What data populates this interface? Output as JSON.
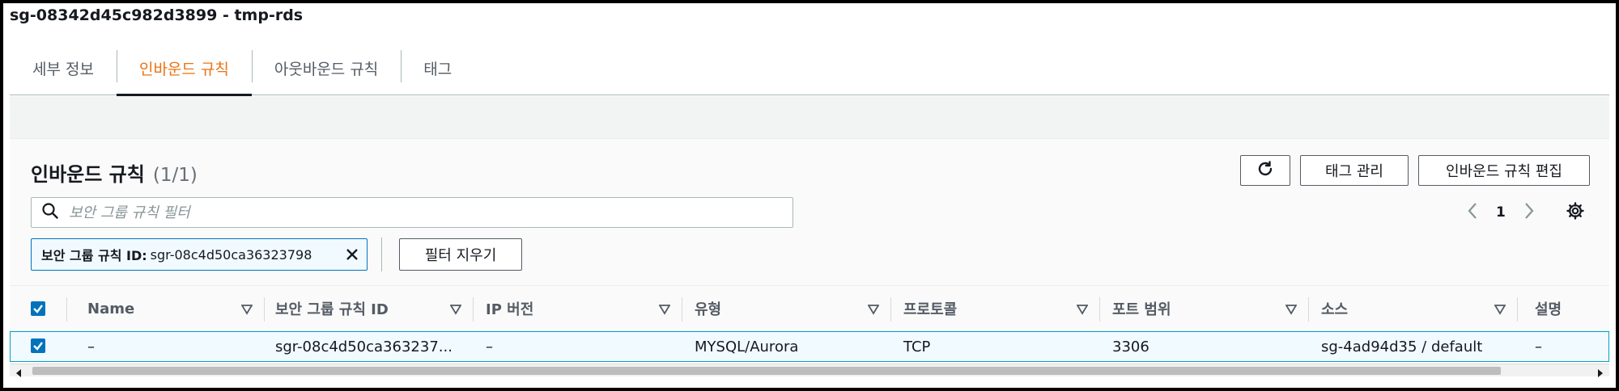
{
  "security_group": {
    "title": "sg-08342d45c982d3899 - tmp-rds"
  },
  "tabs": [
    {
      "label": "세부 정보",
      "active": false
    },
    {
      "label": "인바운드 규칙",
      "active": true
    },
    {
      "label": "아웃바운드 규칙",
      "active": false
    },
    {
      "label": "태그",
      "active": false
    }
  ],
  "panel": {
    "title": "인바운드 규칙",
    "count": "(1/1)",
    "refresh_icon": "refresh-icon",
    "manage_tags_label": "태그 관리",
    "edit_inbound_label": "인바운드 규칙 편집"
  },
  "search": {
    "placeholder": "보안 그룹 규칙 필터",
    "value": ""
  },
  "pagination": {
    "current_page": "1"
  },
  "filter_chip": {
    "key": "보안 그룹 규칙 ID:",
    "value": "sgr-08c4d50ca36323798"
  },
  "clear_filters_label": "필터 지우기",
  "table": {
    "columns": [
      "Name",
      "보안 그룹 규칙 ID",
      "IP 버전",
      "유형",
      "프로토콜",
      "포트 범위",
      "소스",
      "설명"
    ],
    "rows": [
      {
        "selected": true,
        "name": "–",
        "rule_id": "sgr-08c4d50ca363237...",
        "ip_version": "–",
        "type": "MYSQL/Aurora",
        "protocol": "TCP",
        "port_range": "3306",
        "source": "sg-4ad94d35 / default",
        "description": "–"
      }
    ]
  },
  "colors": {
    "accent": "#ec7211",
    "link_blue": "#0073bb",
    "row_selected_bg": "#f1faff"
  }
}
